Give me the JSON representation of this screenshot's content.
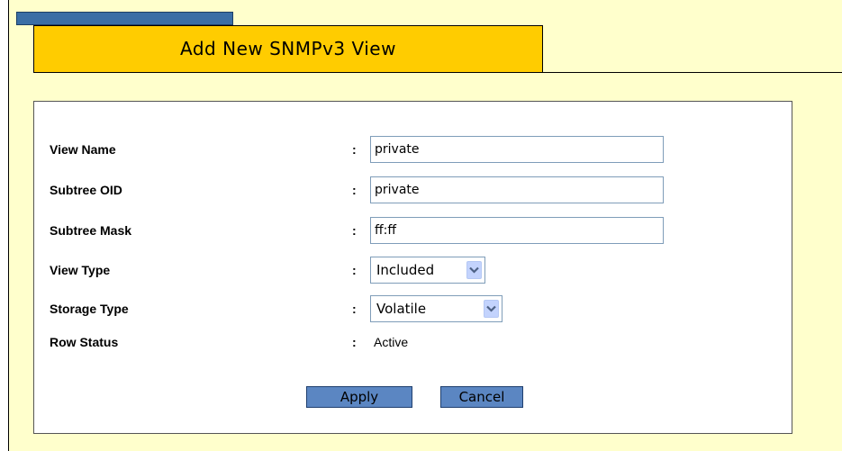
{
  "page": {
    "title": "Add New SNMPv3 View"
  },
  "form": {
    "view_name": {
      "label": "View Name",
      "colon": ":",
      "value": "private"
    },
    "subtree_oid": {
      "label": "Subtree OID",
      "colon": ":",
      "value": "private"
    },
    "subtree_mask": {
      "label": "Subtree Mask",
      "colon": ":",
      "value": "ff:ff"
    },
    "view_type": {
      "label": "View Type",
      "colon": ":",
      "selected": "Included"
    },
    "storage_type": {
      "label": "Storage Type",
      "colon": ":",
      "selected": "Volatile"
    },
    "row_status": {
      "label": "Row Status",
      "colon": ":",
      "value": "Active"
    }
  },
  "buttons": {
    "apply_label": "Apply",
    "cancel_label": "Cancel"
  },
  "colors": {
    "frame_background": "#ffffcc",
    "title_band": "#ffcc00",
    "header_tab": "#3a6ea5",
    "button_fill": "#5b86c2",
    "select_arrow": "#c3d3fd"
  },
  "icons": {
    "dropdown": "chevron-down-icon"
  }
}
